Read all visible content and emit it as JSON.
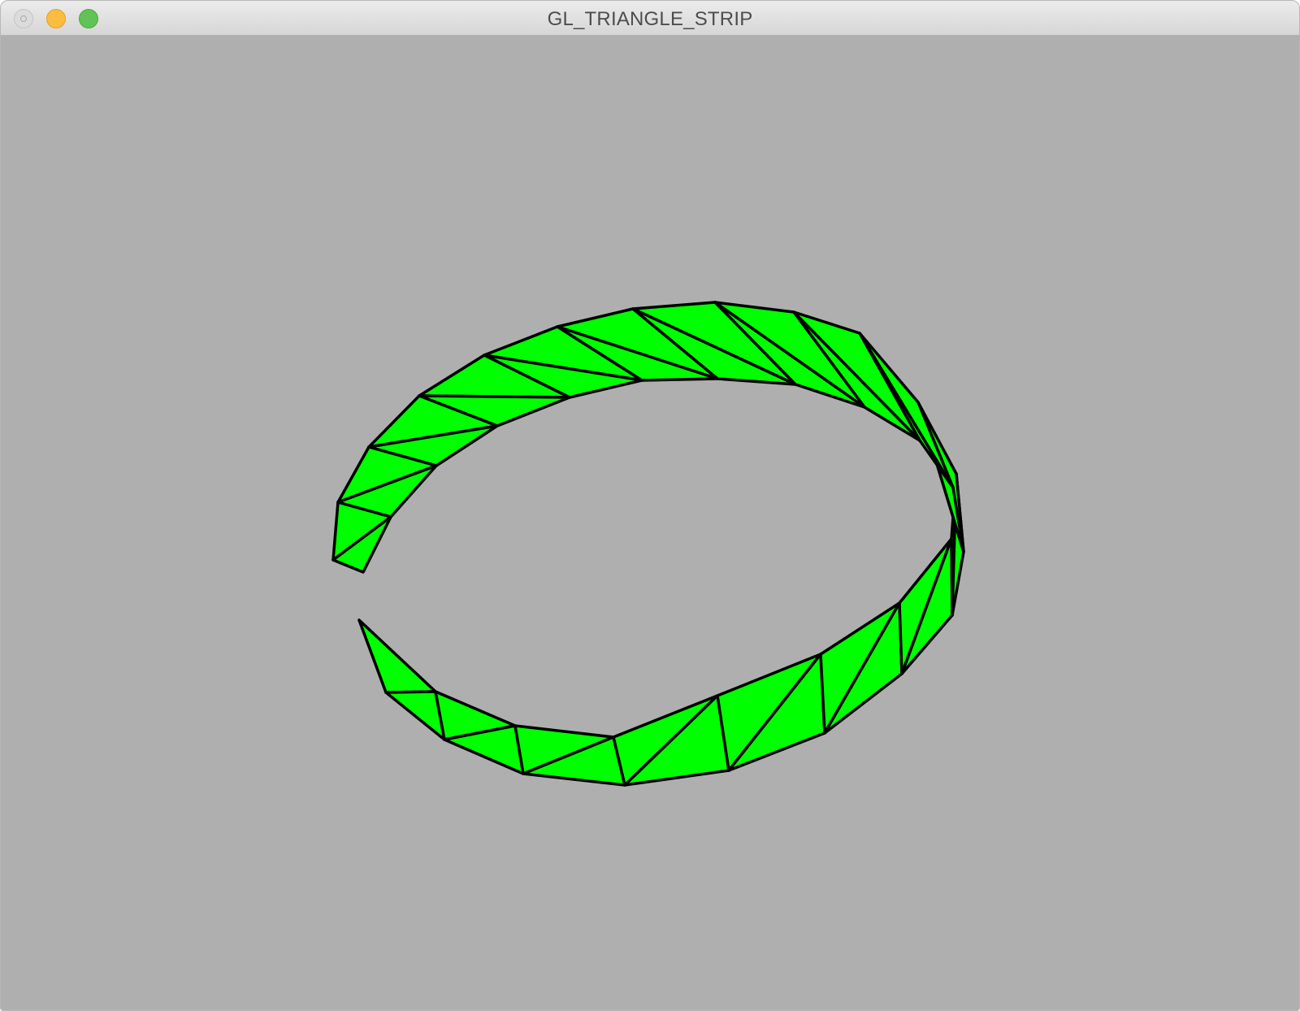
{
  "window": {
    "title": "GL_TRIANGLE_STRIP"
  },
  "traffic_lights": {
    "close_color": "#dcdcdc",
    "minimize_color": "#fbbd3f",
    "zoom_color": "#5fc453"
  },
  "viewport": {
    "background_color": "#afafaf",
    "primitive": "GL_TRIANGLE_STRIP",
    "shape": "ring band",
    "fill_color": "#00ff00",
    "edge_color": "#000000",
    "segments": 24
  }
}
